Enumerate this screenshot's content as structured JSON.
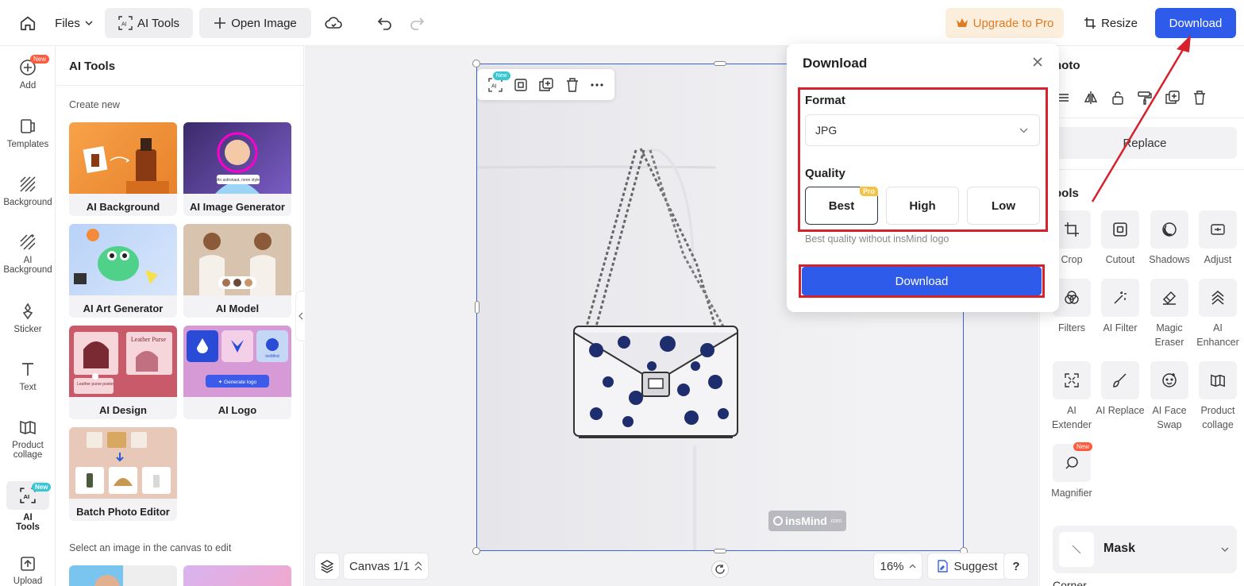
{
  "topbar": {
    "files_label": "Files",
    "ai_tools_label": "AI Tools",
    "open_image_label": "Open Image",
    "upgrade_label": "Upgrade to Pro",
    "resize_label": "Resize",
    "download_label": "Download"
  },
  "leftnav": {
    "items": [
      {
        "label": "Add",
        "badge": "New",
        "icon": "plus-circle-icon"
      },
      {
        "label": "Templates",
        "icon": "templates-icon"
      },
      {
        "label": "Background",
        "icon": "background-icon"
      },
      {
        "label": "AI Background",
        "icon": "ai-background-icon"
      },
      {
        "label": "Sticker",
        "icon": "sticker-icon"
      },
      {
        "label": "Text",
        "icon": "text-icon"
      },
      {
        "label": "Product collage",
        "icon": "collage-icon"
      },
      {
        "label": "AI Tools",
        "badge": "New",
        "icon": "ai-tools-icon"
      },
      {
        "label": "Upload",
        "icon": "upload-icon"
      }
    ]
  },
  "panel": {
    "title": "AI Tools",
    "create_new": "Create new",
    "select_hint": "Select an image in the canvas to edit",
    "cards": [
      {
        "label": "AI Background"
      },
      {
        "label": "AI Image Generator",
        "thumb_caption": "An astronaut, neon style"
      },
      {
        "label": "AI Art Generator"
      },
      {
        "label": "AI Model"
      },
      {
        "label": "AI Design",
        "thumb_text_1": "Leather Purse",
        "thumb_text_2": "Leather purse poster"
      },
      {
        "label": "AI Logo",
        "thumb_button": "✦ Generate logo",
        "thumb_brand": "insMind"
      },
      {
        "label": "Batch Photo Editor"
      }
    ]
  },
  "canvas": {
    "watermark": "insMind",
    "watermark_suffix": ".com",
    "canvas_label": "Canvas 1/1",
    "zoom": "16%",
    "suggest_label": "Suggest",
    "help_label": "?",
    "float_badge": "New"
  },
  "modal": {
    "title": "Download",
    "format_label": "Format",
    "format_value": "JPG",
    "quality_label": "Quality",
    "quality_options": [
      "Best",
      "High",
      "Low"
    ],
    "pro_badge": "Pro",
    "hint": "Best quality without insMind logo",
    "download_button": "Download"
  },
  "rightpanel": {
    "section_title": "hoto",
    "replace_label": "Replace",
    "tools_title": "ools",
    "tools": [
      {
        "label": "Crop",
        "icon": "crop-icon"
      },
      {
        "label": "Cutout",
        "icon": "cutout-icon"
      },
      {
        "label": "Shadows",
        "icon": "shadows-icon"
      },
      {
        "label": "Adjust",
        "icon": "adjust-icon"
      },
      {
        "label": "Filters",
        "icon": "filters-icon"
      },
      {
        "label": "AI Filter",
        "icon": "ai-filter-icon"
      },
      {
        "label": "Magic Eraser",
        "icon": "eraser-icon"
      },
      {
        "label": "AI Enhancer",
        "icon": "enhancer-icon"
      },
      {
        "label": "AI Extender",
        "icon": "extender-icon"
      },
      {
        "label": "AI Replace",
        "icon": "replace-brush-icon"
      },
      {
        "label": "AI Face Swap",
        "icon": "face-swap-icon"
      },
      {
        "label": "Product collage",
        "icon": "collage-icon"
      },
      {
        "label": "Magnifier",
        "icon": "magnifier-icon",
        "badge": "New"
      }
    ],
    "mask_label": "Mask",
    "corner_label": "Corner"
  },
  "colors": {
    "primary": "#2f5bea",
    "annotation_red": "#d6222c",
    "upgrade_bg": "#fbeedd",
    "upgrade_text": "#e07b22"
  }
}
